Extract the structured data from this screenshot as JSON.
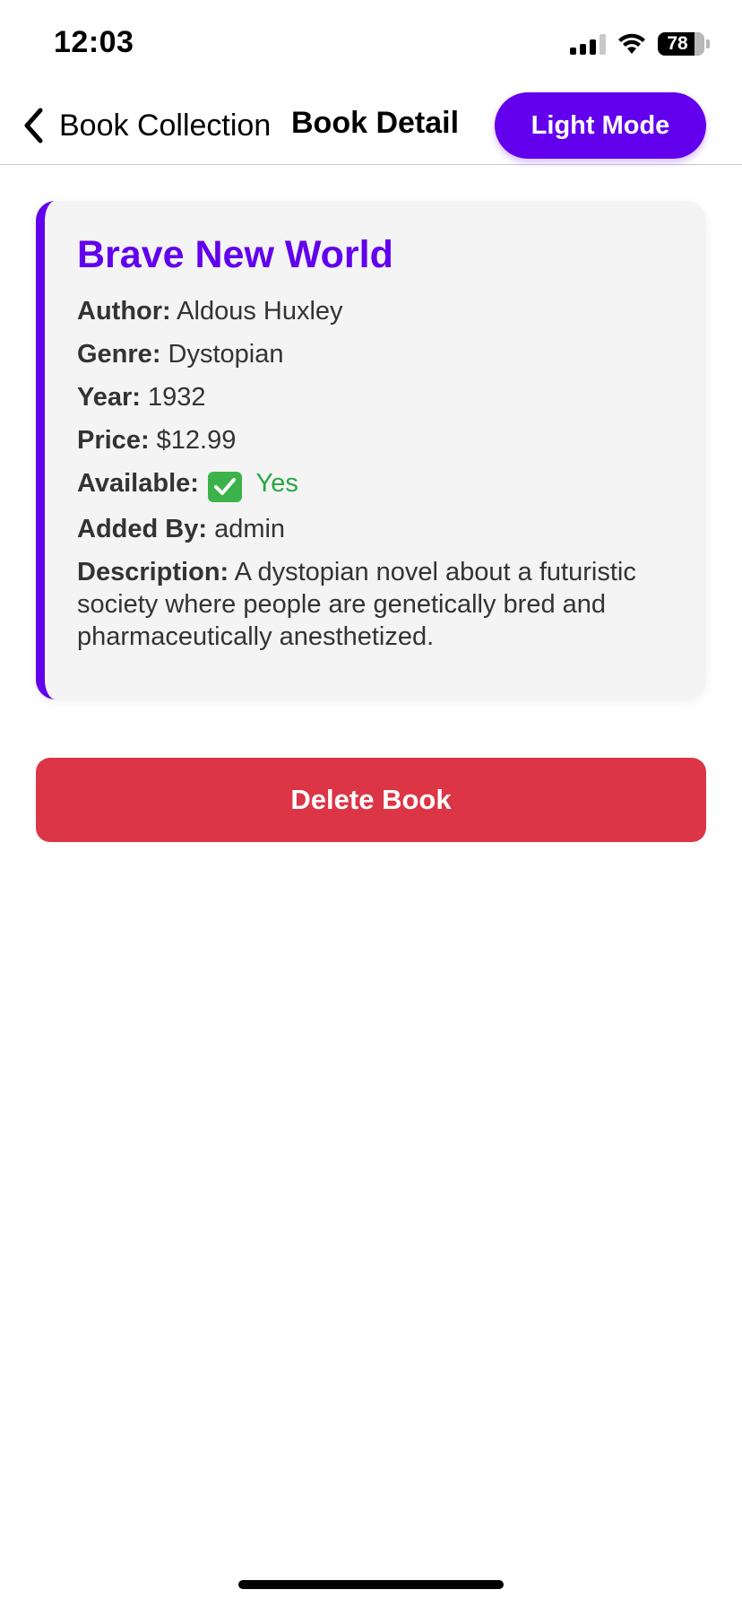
{
  "status_bar": {
    "time": "12:03",
    "battery_percent": "78",
    "icons": [
      "signal-icon",
      "wifi-icon",
      "battery-icon"
    ]
  },
  "nav": {
    "back_label": "Book Collection",
    "title": "Book Detail",
    "mode_button_label": "Light Mode"
  },
  "book": {
    "title": "Brave New World",
    "fields": {
      "author_label": "Author:",
      "author": "Aldous Huxley",
      "genre_label": "Genre:",
      "genre": "Dystopian",
      "year_label": "Year:",
      "year": "1932",
      "price_label": "Price:",
      "price": "$12.99",
      "available_label": "Available:",
      "available": "Yes",
      "added_by_label": "Added By:",
      "added_by": "admin",
      "description_label": "Description:",
      "description": "A dystopian novel about a futuristic society where people are genetically bred and pharmaceutically anesthetized."
    }
  },
  "actions": {
    "delete_label": "Delete Book"
  },
  "colors": {
    "accent": "#6200ee",
    "danger": "#dc3545",
    "success": "#28a745",
    "card_bg": "#f4f4f4"
  }
}
